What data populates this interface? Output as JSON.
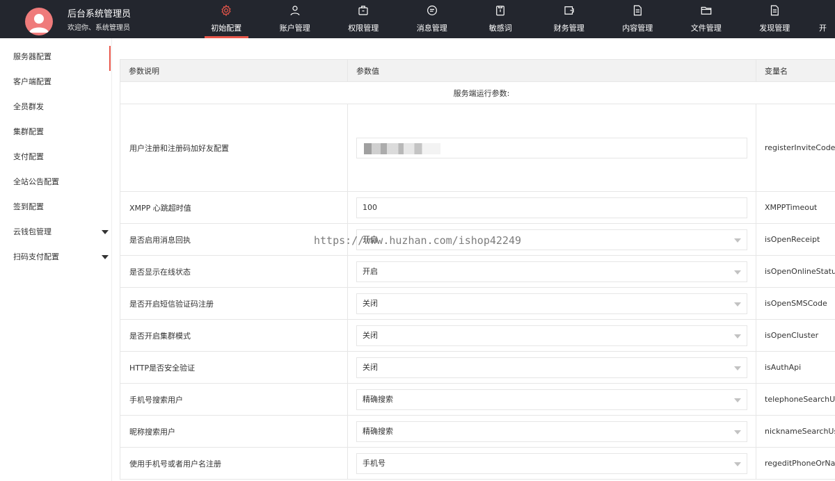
{
  "header": {
    "title": "后台系统管理员",
    "subtitle": "欢迎你、系统管理员",
    "brand_color": "#23262e",
    "accent_color": "#e8564a",
    "nav": [
      {
        "label": "初始配置",
        "icon": "gear-icon",
        "active": true
      },
      {
        "label": "账户管理",
        "icon": "user-icon"
      },
      {
        "label": "权限管理",
        "icon": "briefcase-icon"
      },
      {
        "label": "消息管理",
        "icon": "chat-icon"
      },
      {
        "label": "敏感词",
        "icon": "clipboard-icon"
      },
      {
        "label": "财务管理",
        "icon": "wallet-icon"
      },
      {
        "label": "内容管理",
        "icon": "document-icon"
      },
      {
        "label": "文件管理",
        "icon": "folder-icon"
      },
      {
        "label": "发现管理",
        "icon": "document-icon"
      },
      {
        "label": "开",
        "icon": ""
      }
    ]
  },
  "sidebar": {
    "items": [
      {
        "label": "服务器配置",
        "active": true
      },
      {
        "label": "客户端配置"
      },
      {
        "label": "全员群发"
      },
      {
        "label": "集群配置"
      },
      {
        "label": "支付配置"
      },
      {
        "label": "全站公告配置"
      },
      {
        "label": "签到配置"
      },
      {
        "label": "云钱包管理",
        "expandable": true
      },
      {
        "label": "扫码支付配置",
        "expandable": true
      }
    ]
  },
  "table": {
    "headers": {
      "desc": "参数说明",
      "value": "参数值",
      "var": "变量名"
    },
    "section": "服务端运行参数:",
    "rows": [
      {
        "desc": "用户注册和注册码加好友配置",
        "value": "",
        "var": "registerInviteCodeSe",
        "kind": "input-blurred"
      },
      {
        "desc": "XMPP 心跳超时值",
        "value": "100",
        "var": "XMPPTimeout",
        "kind": "input"
      },
      {
        "desc": "是否启用消息回执",
        "value": "开启",
        "var": "isOpenReceipt",
        "kind": "select"
      },
      {
        "desc": "是否显示在线状态",
        "value": "开启",
        "var": "isOpenOnlineStatus",
        "kind": "select"
      },
      {
        "desc": "是否开启短信验证码注册",
        "value": "关闭",
        "var": "isOpenSMSCode",
        "kind": "select"
      },
      {
        "desc": "是否开启集群模式",
        "value": "关闭",
        "var": "isOpenCluster",
        "kind": "select"
      },
      {
        "desc": "HTTP是否安全验证",
        "value": "关闭",
        "var": "isAuthApi",
        "kind": "select"
      },
      {
        "desc": "手机号搜索用户",
        "value": "精确搜索",
        "var": "telephoneSearchUse",
        "kind": "select"
      },
      {
        "desc": "昵称搜索用户",
        "value": "精确搜索",
        "var": "nicknameSearchUse",
        "kind": "select"
      },
      {
        "desc": "使用手机号或者用户名注册",
        "value": "手机号",
        "var": "regeditPhoneOrNam",
        "kind": "select"
      }
    ]
  },
  "watermark": "https://www.huzhan.com/ishop42249"
}
